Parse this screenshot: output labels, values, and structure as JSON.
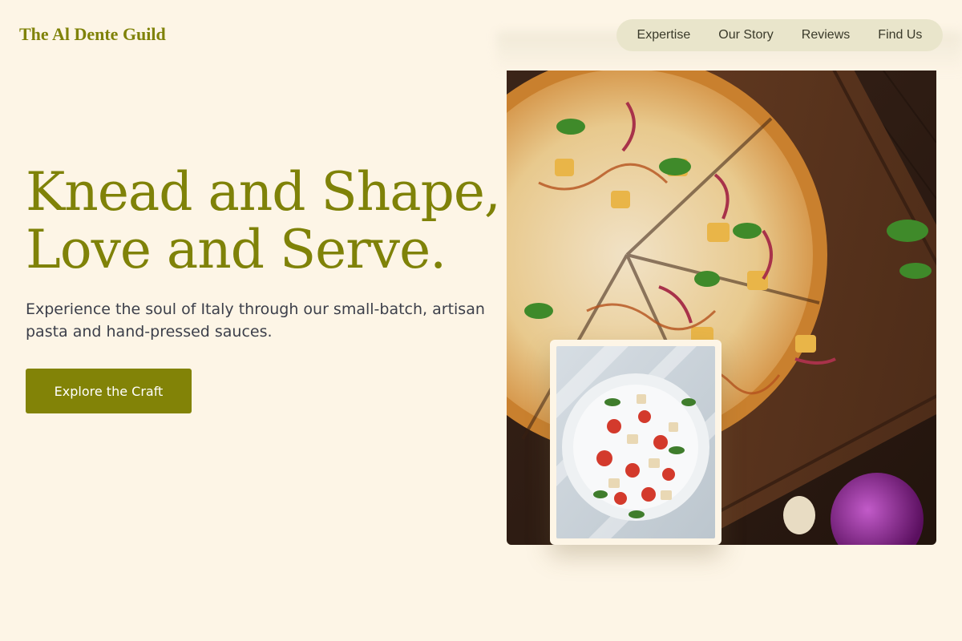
{
  "brand": {
    "name": "The Al Dente Guild"
  },
  "nav": {
    "items": [
      {
        "label": "Expertise"
      },
      {
        "label": "Our Story"
      },
      {
        "label": "Reviews"
      },
      {
        "label": "Find Us"
      }
    ]
  },
  "hero": {
    "title_line1": "Knead and Shape,",
    "title_line2": "Love and Serve.",
    "subtitle": "Experience the soul of Italy through our small-batch, artisan pasta and hand-pressed sauces.",
    "cta_label": "Explore the Craft"
  },
  "images": {
    "main": "pizza-on-wooden-board",
    "inset": "salad-plate-photo"
  },
  "colors": {
    "background": "#fdf5e6",
    "accent": "#7f8208",
    "button": "#828307",
    "nav_pill": "#e9e5cb",
    "body_text": "#3c3f4a"
  }
}
